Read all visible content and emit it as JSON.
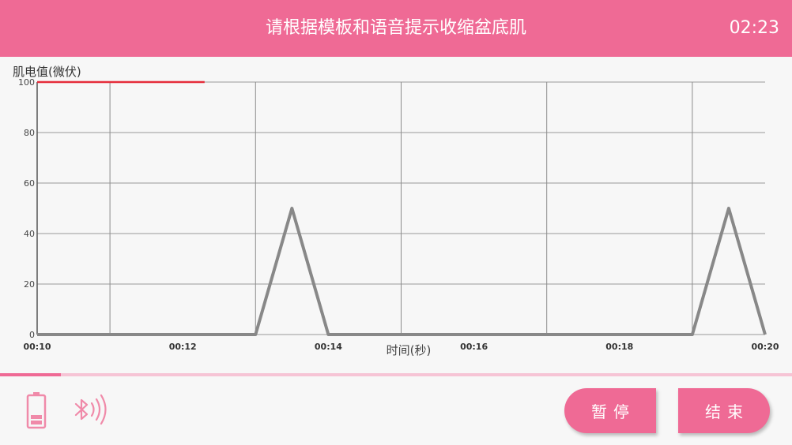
{
  "header": {
    "title": "请根据模板和语音提示收缩盆底肌",
    "timer": "02:23",
    "color": "#ef6a95"
  },
  "chart_data": {
    "type": "line",
    "ylabel": "肌电值(微伏)",
    "xlabel": "时间(秒)",
    "ylim": [
      0,
      100
    ],
    "yticks": [
      0,
      20,
      40,
      60,
      80,
      100
    ],
    "xlim": [
      10,
      20
    ],
    "xticks": [
      "00:10",
      "00:12",
      "00:14",
      "00:16",
      "00:18",
      "00:20"
    ],
    "grid": true,
    "series": [
      {
        "color": "#888888",
        "x": [
          10,
          13,
          13.5,
          14,
          19,
          19.5,
          20
        ],
        "y": [
          0,
          0,
          50,
          0,
          0,
          50,
          0
        ]
      },
      {
        "color": "#e52d3a",
        "x": [
          10,
          12.3
        ],
        "y": [
          100,
          100
        ]
      }
    ]
  },
  "progress": {
    "fraction": 0.077,
    "color": "#ef6a95"
  },
  "status": {
    "battery_icon": "battery-low-icon",
    "bluetooth_icon": "bluetooth-connected-icon"
  },
  "buttons": {
    "pause": "暂停",
    "end": "结束"
  }
}
